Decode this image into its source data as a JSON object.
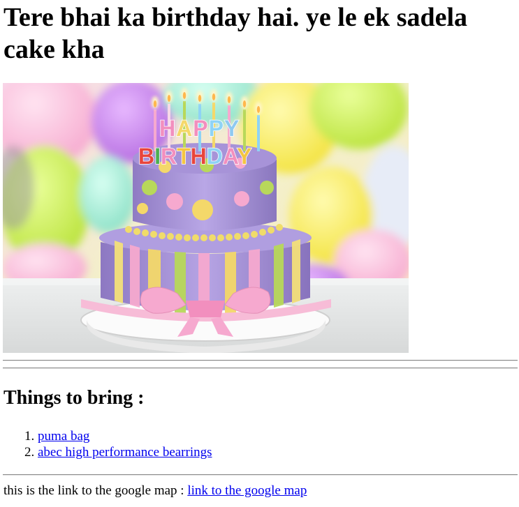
{
  "page": {
    "title": "Tere bhai ka birthday hai. ye le ek sadela cake kha"
  },
  "image": {
    "cake_text_line1": "HAPPY",
    "cake_text_line2": "BIRTHDAY",
    "icon": "birthday-cake-photo"
  },
  "bring_section": {
    "heading": "Things to bring :",
    "items": [
      {
        "label": "puma bag"
      },
      {
        "label": "abec high performance bearrings"
      }
    ]
  },
  "map": {
    "prefix": "this is the link to the google map : ",
    "link_label": "link to the google map"
  },
  "colors": {
    "link": "#0000ee",
    "text": "#000000",
    "rule": "#8a8a8a"
  }
}
